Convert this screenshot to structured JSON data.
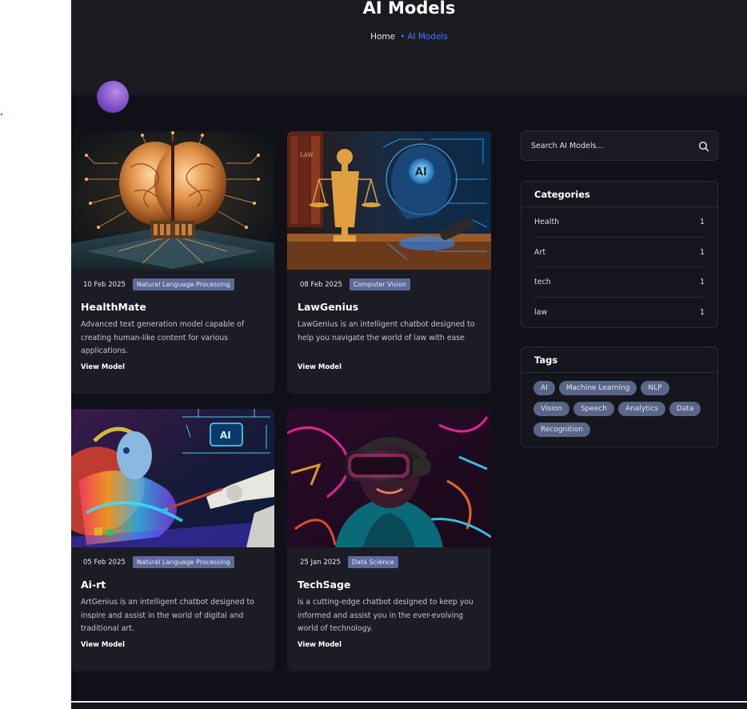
{
  "hero": {
    "title": "AI Models",
    "breadcrumb_home": "Home",
    "breadcrumb_sep": "•",
    "breadcrumb_current": "AI Models"
  },
  "models": [
    {
      "date": "10 Feb 2025",
      "category": "Natural Language Processing",
      "title": "HealthMate",
      "description": "Advanced text generation model capable of creating human-like content for various applications.",
      "link": "View Model"
    },
    {
      "date": "08 Feb 2025",
      "category": "Computer Vision",
      "title": "LawGenius",
      "description": "LawGenius is an intelligent chatbot designed to help you navigate the world of law with ease",
      "link": "View Model"
    },
    {
      "date": "05 Feb 2025",
      "category": "Natural Language Processing",
      "title": "Ai-rt",
      "description": "ArtGenius is an intelligent chatbot designed to inspire and assist in the world of digital and traditional art.",
      "link": "View Model"
    },
    {
      "date": "25 Jan 2025",
      "category": "Data Science",
      "title": "TechSage",
      "description": "is a cutting-edge chatbot designed to keep you informed and assist you in the ever-evolving world of technology.",
      "link": "View Model"
    }
  ],
  "search": {
    "placeholder": "Search AI Models...",
    "icon": "search-icon"
  },
  "categories": {
    "title": "Categories",
    "items": [
      {
        "label": "Health",
        "count": "1"
      },
      {
        "label": "Art",
        "count": "1"
      },
      {
        "label": "tech",
        "count": "1"
      },
      {
        "label": "law",
        "count": "1"
      }
    ]
  },
  "tags": {
    "title": "Tags",
    "items": [
      "AI",
      "Machine Learning",
      "NLP",
      "Vision",
      "Speech",
      "Analytics",
      "Data",
      "Recognition"
    ]
  },
  "images": {
    "card1": "ai-brain-circuit-image",
    "card2": "justice-statue-ai-image",
    "card3": "robot-artist-ai-image",
    "card4": "vr-headset-neon-image"
  },
  "image_text": {
    "ai_badge": "AI",
    "law_book": "LAW"
  },
  "colors": {
    "background": "#0f1018",
    "card": "#1b1c24",
    "accent": "#3d7bff",
    "category_badge": "#5e6b9a",
    "tag": "#5a6688"
  }
}
